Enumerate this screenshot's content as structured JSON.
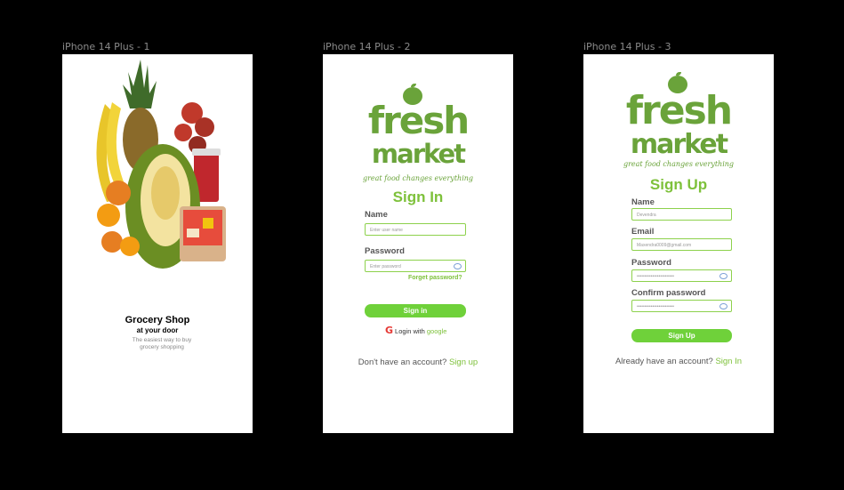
{
  "frames": [
    {
      "label": "iPhone 14 Plus - 1"
    },
    {
      "label": "iPhone 14 Plus - 2"
    },
    {
      "label": "iPhone 14 Plus - 3"
    }
  ],
  "splash": {
    "title": "Grocery Shop",
    "subtitle": "at your  door",
    "description_line1": "The easiest way to buy",
    "description_line2": "grocery shopping"
  },
  "logo": {
    "word1": "fresh",
    "word2": "market",
    "tagline": "great food changes everything"
  },
  "signin": {
    "heading": "Sign In",
    "name_label": "Name",
    "name_placeholder": "Enter user name",
    "password_label": "Password",
    "password_placeholder": "Enter password",
    "forgot": "Forget password?",
    "button": "Sign in",
    "google_prefix": "Login with ",
    "google_word": "google",
    "google_icon": "G",
    "footer_text": "Don't have an account? ",
    "footer_link": "Sign up"
  },
  "signup": {
    "heading": "Sign Up",
    "name_label": "Name",
    "name_value": "Devendra",
    "email_label": "Email",
    "email_value": "Maxendra0009@gmail.com",
    "password_label": "Password",
    "password_value": "••••••••••••••••••••••••",
    "confirm_label": "Confirm password",
    "confirm_value": "••••••••••••••••••••••••",
    "button": "Sign Up",
    "footer_text": "Already have an account? ",
    "footer_link": "Sign In"
  },
  "colors": {
    "brand": "#6aa33a",
    "accent": "#7ec13b",
    "button": "#6fd13a"
  }
}
